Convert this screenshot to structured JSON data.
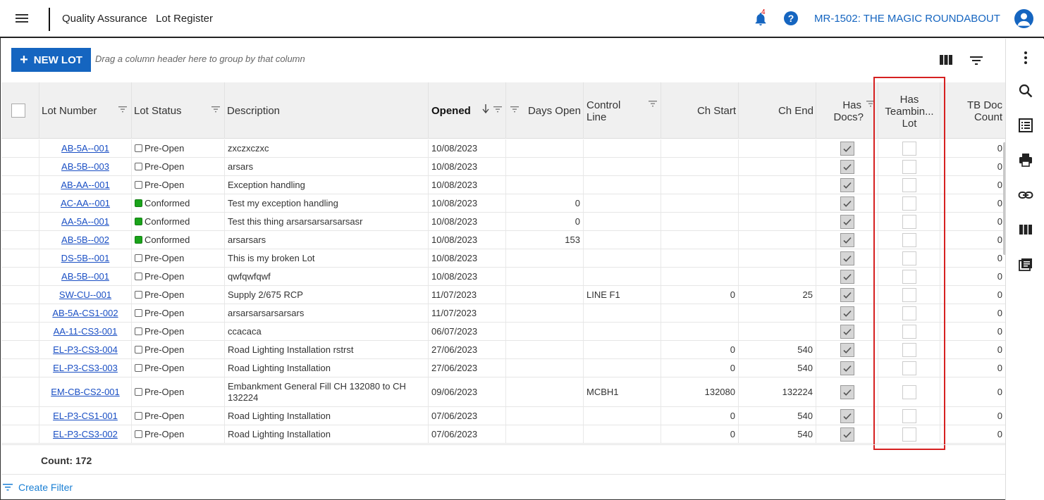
{
  "header": {
    "breadcrumbs": [
      "Quality Assurance",
      "Lot Register"
    ],
    "notification_count": "4",
    "project": "MR-1502: THE MAGIC ROUNDABOUT"
  },
  "toolbar": {
    "new_lot_label": "NEW LOT",
    "group_hint": "Drag a column header here to group by that column"
  },
  "columns": {
    "lot_number": "Lot Number",
    "lot_status": "Lot Status",
    "description": "Description",
    "opened": "Opened",
    "days_open": "Days Open",
    "control_line_1": "Control",
    "control_line_2": "Line",
    "ch_start": "Ch Start",
    "ch_end": "Ch End",
    "has_docs_1": "Has",
    "has_docs_2": "Docs?",
    "teambin_1": "Has",
    "teambin_2": "Teambin...",
    "teambin_3": "Lot",
    "tb_doc_1": "TB Doc",
    "tb_doc_2": "Count"
  },
  "rows": [
    {
      "lot": "AB-5A--001",
      "status": "Pre-Open",
      "conformed": false,
      "desc": "zxczxczxc",
      "opened": "10/08/2023",
      "days": "",
      "line": "",
      "chs": "",
      "che": "",
      "tb": "0"
    },
    {
      "lot": "AB-5B--003",
      "status": "Pre-Open",
      "conformed": false,
      "desc": "arsars",
      "opened": "10/08/2023",
      "days": "",
      "line": "",
      "chs": "",
      "che": "",
      "tb": "0"
    },
    {
      "lot": "AB-AA--001",
      "status": "Pre-Open",
      "conformed": false,
      "desc": "Exception handling",
      "opened": "10/08/2023",
      "days": "",
      "line": "",
      "chs": "",
      "che": "",
      "tb": "0"
    },
    {
      "lot": "AC-AA--001",
      "status": "Conformed",
      "conformed": true,
      "desc": "Test my exception handling",
      "opened": "10/08/2023",
      "days": "0",
      "line": "",
      "chs": "",
      "che": "",
      "tb": "0"
    },
    {
      "lot": "AA-5A--001",
      "status": "Conformed",
      "conformed": true,
      "desc": "Test this thing arsarsarsarsarsasr",
      "opened": "10/08/2023",
      "days": "0",
      "line": "",
      "chs": "",
      "che": "",
      "tb": "0"
    },
    {
      "lot": "AB-5B--002",
      "status": "Conformed",
      "conformed": true,
      "desc": "arsarsars",
      "opened": "10/08/2023",
      "days": "153",
      "line": "",
      "chs": "",
      "che": "",
      "tb": "0"
    },
    {
      "lot": "DS-5B--001",
      "status": "Pre-Open",
      "conformed": false,
      "desc": "This is my broken Lot",
      "opened": "10/08/2023",
      "days": "",
      "line": "",
      "chs": "",
      "che": "",
      "tb": "0"
    },
    {
      "lot": "AB-5B--001",
      "status": "Pre-Open",
      "conformed": false,
      "desc": "qwfqwfqwf",
      "opened": "10/08/2023",
      "days": "",
      "line": "",
      "chs": "",
      "che": "",
      "tb": "0"
    },
    {
      "lot": "SW-CU--001",
      "status": "Pre-Open",
      "conformed": false,
      "desc": "Supply 2/675 RCP",
      "opened": "11/07/2023",
      "days": "",
      "line": "LINE F1",
      "chs": "0",
      "che": "25",
      "tb": "0"
    },
    {
      "lot": "AB-5A-CS1-002",
      "status": "Pre-Open",
      "conformed": false,
      "desc": "arsarsarsarsarsars",
      "opened": "11/07/2023",
      "days": "",
      "line": "",
      "chs": "",
      "che": "",
      "tb": "0"
    },
    {
      "lot": "AA-11-CS3-001",
      "status": "Pre-Open",
      "conformed": false,
      "desc": "ccacaca",
      "opened": "06/07/2023",
      "days": "",
      "line": "",
      "chs": "",
      "che": "",
      "tb": "0"
    },
    {
      "lot": "EL-P3-CS3-004",
      "status": "Pre-Open",
      "conformed": false,
      "desc": "Road Lighting Installation rstrst",
      "opened": "27/06/2023",
      "days": "",
      "line": "",
      "chs": "0",
      "che": "540",
      "tb": "0"
    },
    {
      "lot": "EL-P3-CS3-003",
      "status": "Pre-Open",
      "conformed": false,
      "desc": "Road Lighting Installation",
      "opened": "27/06/2023",
      "days": "",
      "line": "",
      "chs": "0",
      "che": "540",
      "tb": "0"
    },
    {
      "lot": "EM-CB-CS2-001",
      "status": "Pre-Open",
      "conformed": false,
      "desc": "Embankment General Fill CH 132080 to CH 132224",
      "opened": "09/06/2023",
      "days": "",
      "line": "MCBH1",
      "chs": "132080",
      "che": "132224",
      "tb": "0"
    },
    {
      "lot": "EL-P3-CS1-001",
      "status": "Pre-Open",
      "conformed": false,
      "desc": "Road Lighting Installation",
      "opened": "07/06/2023",
      "days": "",
      "line": "",
      "chs": "0",
      "che": "540",
      "tb": "0"
    },
    {
      "lot": "EL-P3-CS3-002",
      "status": "Pre-Open",
      "conformed": false,
      "desc": "Road Lighting Installation",
      "opened": "07/06/2023",
      "days": "",
      "line": "",
      "chs": "0",
      "che": "540",
      "tb": "0"
    }
  ],
  "footer": {
    "count_label": "Count: 172",
    "create_filter": "Create Filter"
  },
  "colors": {
    "accent": "#1565c0",
    "conformed": "#1aa31a",
    "highlight": "#d62020"
  },
  "icons": [
    "menu-icon",
    "bell-icon",
    "help-icon",
    "user-icon",
    "more-vert-icon",
    "search-icon",
    "list-icon",
    "print-icon",
    "link-icon",
    "columns-icon",
    "document-icon",
    "filter-icon",
    "sort-desc-icon"
  ]
}
